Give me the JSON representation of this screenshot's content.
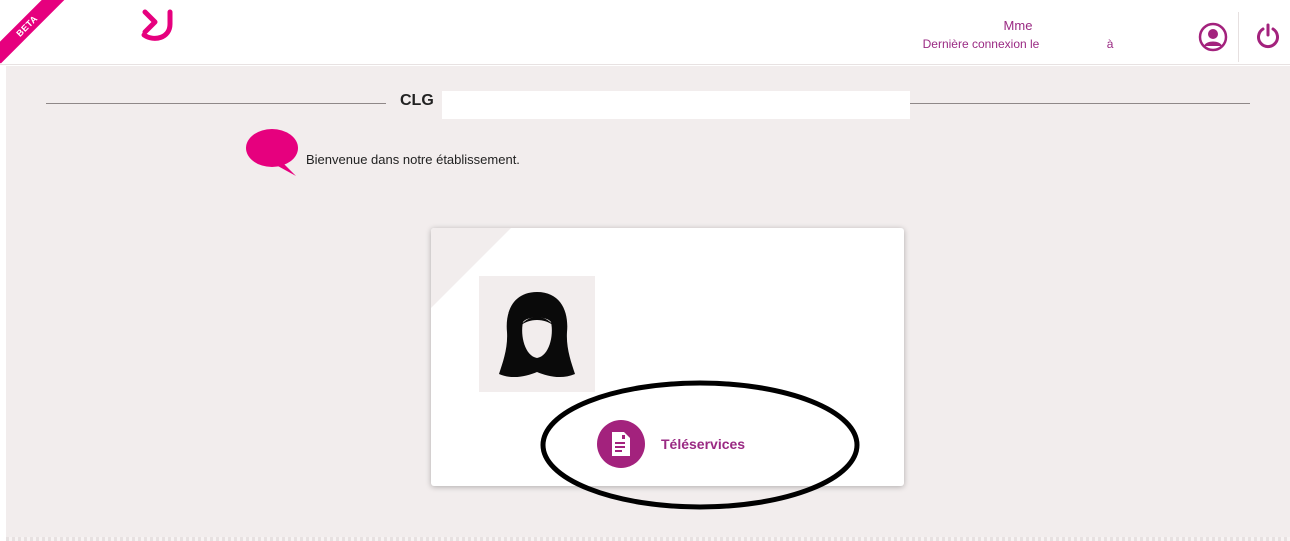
{
  "header": {
    "beta_label": "BETA",
    "user_title": "Mme",
    "last_login_prefix": "Dernière connexion le",
    "last_login_sep": "à",
    "profile_icon": "user-circle-icon",
    "logout_icon": "power-icon",
    "logo_icon": "enta-logo-icon",
    "brand_color": "#e6007e",
    "accent_color": "#9a2a83"
  },
  "school": {
    "title": "CLG",
    "name": ""
  },
  "welcome": {
    "message": "Bienvenue dans notre établissement.",
    "icon": "speech-bubble-icon"
  },
  "card": {
    "avatar_icon": "female-avatar-icon",
    "teleservices_label": "Téléservices",
    "teleservices_icon": "document-icon"
  }
}
